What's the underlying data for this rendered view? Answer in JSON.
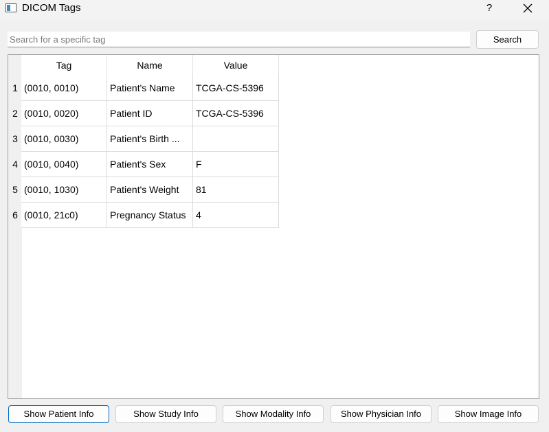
{
  "window": {
    "title": "DICOM Tags",
    "help_label": "?"
  },
  "search": {
    "placeholder": "Search for a specific tag",
    "value": "",
    "button_label": "Search"
  },
  "table": {
    "columns": [
      "Tag",
      "Name",
      "Value"
    ],
    "rows": [
      {
        "index": "1",
        "tag": "(0010, 0010)",
        "name": "Patient's Name",
        "value": "TCGA-CS-5396"
      },
      {
        "index": "2",
        "tag": "(0010, 0020)",
        "name": "Patient ID",
        "value": "TCGA-CS-5396"
      },
      {
        "index": "3",
        "tag": "(0010, 0030)",
        "name": "Patient's Birth ...",
        "value": ""
      },
      {
        "index": "4",
        "tag": "(0010, 0040)",
        "name": "Patient's Sex",
        "value": "F"
      },
      {
        "index": "5",
        "tag": "(0010, 1030)",
        "name": "Patient's Weight",
        "value": "81"
      },
      {
        "index": "6",
        "tag": "(0010, 21c0)",
        "name": "Pregnancy Status",
        "value": "4"
      }
    ]
  },
  "footer": {
    "buttons": [
      {
        "label": "Show Patient Info",
        "active": true
      },
      {
        "label": "Show Study Info",
        "active": false
      },
      {
        "label": "Show Modality Info",
        "active": false
      },
      {
        "label": "Show Physician Info",
        "active": false
      },
      {
        "label": "Show Image Info",
        "active": false
      }
    ]
  },
  "colors": {
    "accent": "#0067c0",
    "window_bg": "#f0f0f0",
    "grid_line": "#dcdcdc"
  }
}
